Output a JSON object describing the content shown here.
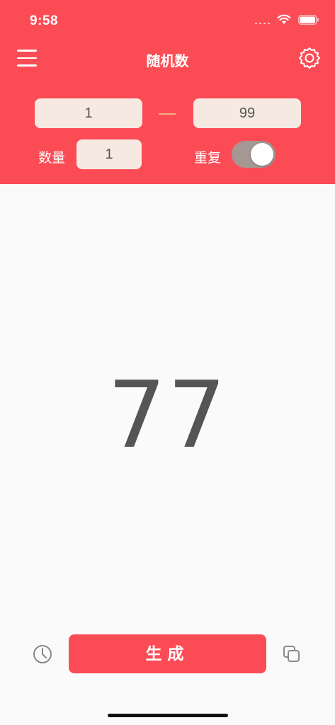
{
  "status_bar": {
    "time": "9:58"
  },
  "header": {
    "title": "随机数"
  },
  "range": {
    "min": "1",
    "max": "99"
  },
  "options": {
    "count_label": "数量",
    "count": "1",
    "repeat_label": "重复",
    "repeat_enabled": true
  },
  "result": {
    "value": "77"
  },
  "actions": {
    "generate_label": "生成"
  },
  "colors": {
    "accent": "#fb4c55",
    "field_bg": "#f5e9e1",
    "toggle_bg": "#a59794"
  },
  "icons": {
    "menu": "hamburger-menu-icon",
    "settings": "gear-icon",
    "history": "clock-icon",
    "copy": "copy-icon"
  }
}
